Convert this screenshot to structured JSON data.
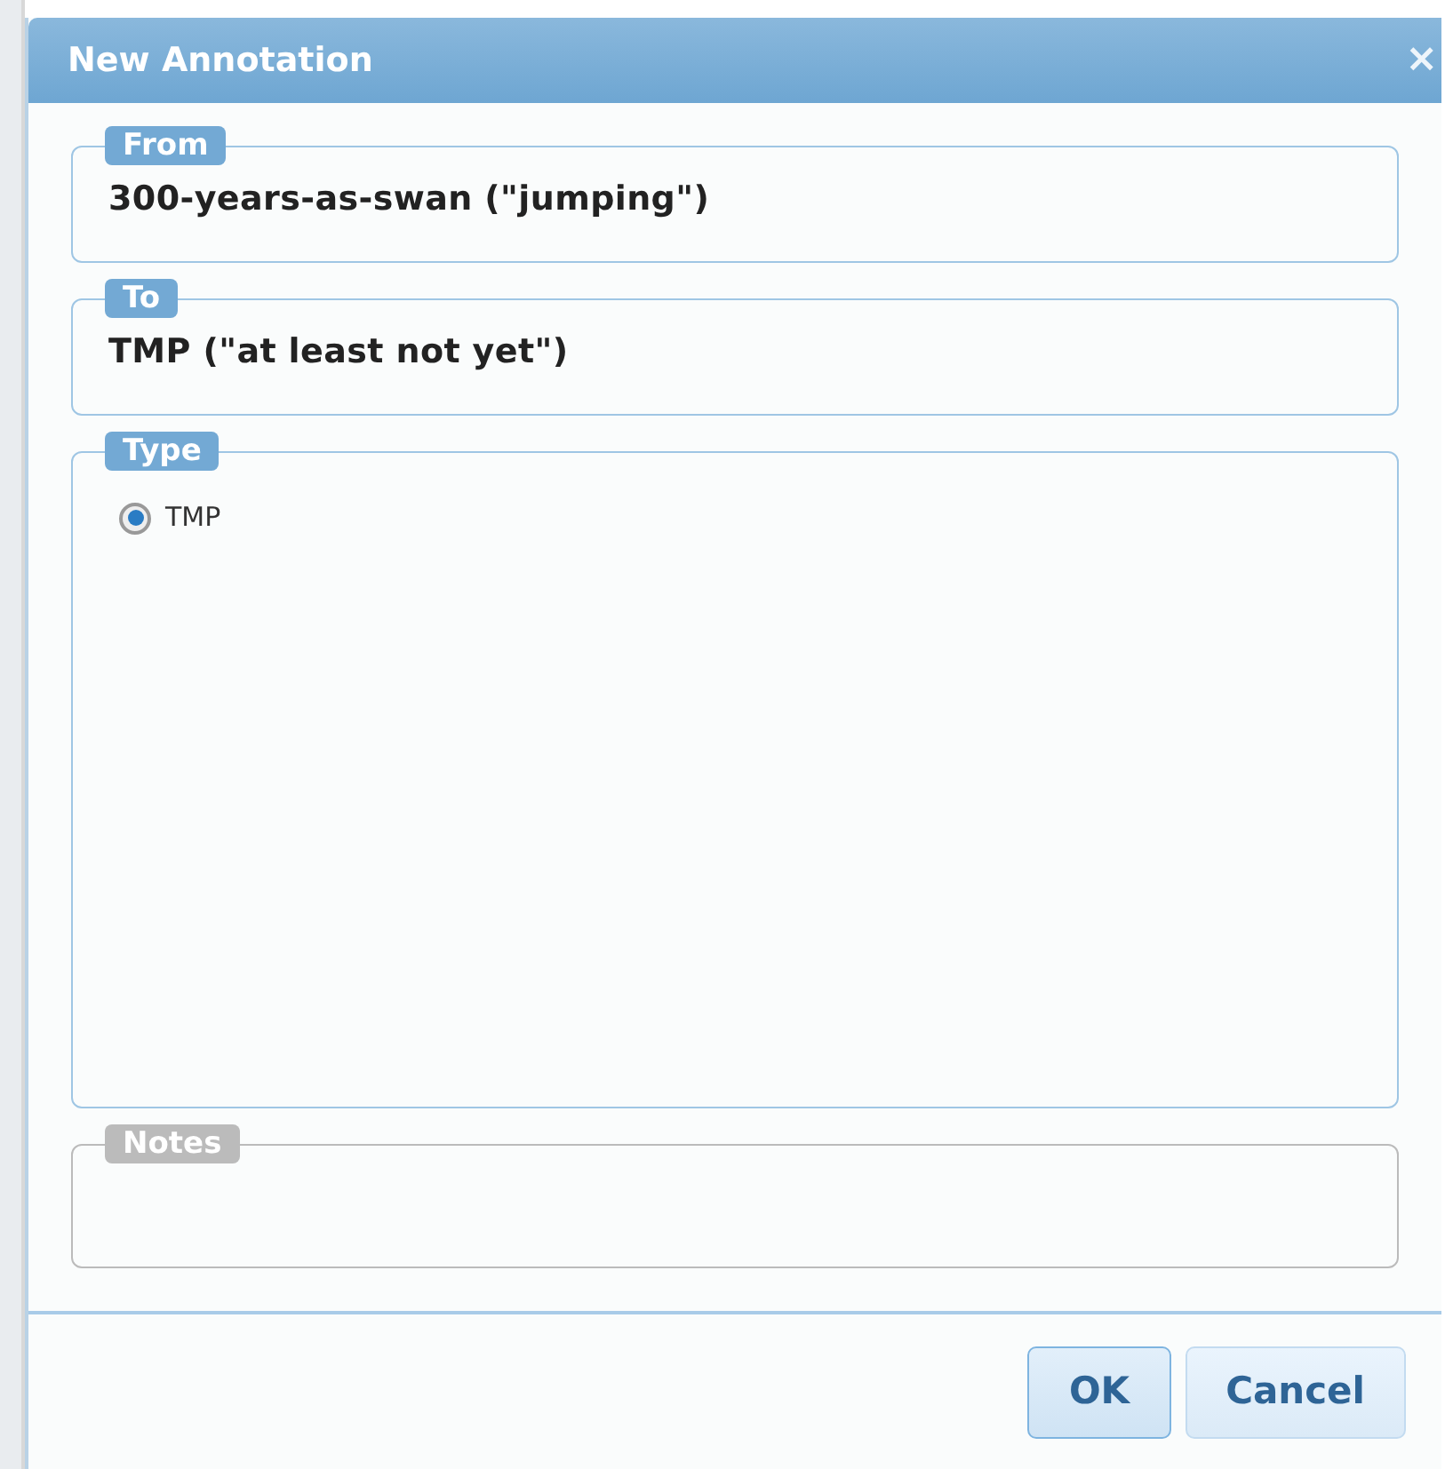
{
  "window": {
    "title": "New Annotation",
    "close": "×"
  },
  "sections": [
    {
      "kind": "text",
      "legend": "From",
      "disabled": false,
      "value": "300-years-as-swan (\"jumping\")"
    },
    {
      "kind": "text",
      "legend": "To",
      "disabled": false,
      "value": "TMP (\"at least not yet\")"
    },
    {
      "kind": "radio",
      "legend": "Type",
      "disabled": false,
      "options": [
        {
          "label": "TMP",
          "selected": true
        }
      ]
    },
    {
      "kind": "notes",
      "legend": "Notes",
      "disabled": true
    }
  ],
  "buttons": [
    {
      "label": "OK",
      "focused": true
    },
    {
      "label": "Cancel",
      "focused": false
    }
  ]
}
